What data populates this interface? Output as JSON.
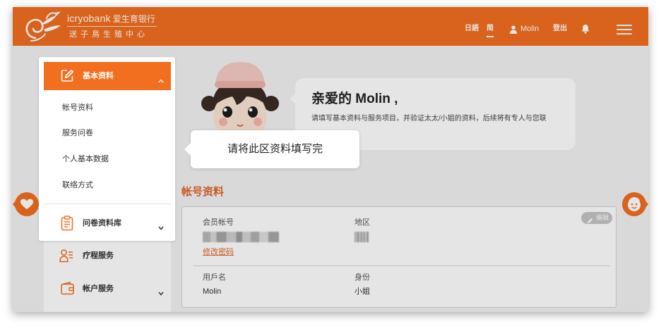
{
  "header": {
    "logo_icon": "stork-bird-logo",
    "brand_name": "icryobank",
    "brand_cn": "爱生育银行",
    "brand_sub": "送子鳥生殖中心",
    "lang_ja": "日語",
    "lang_zh": "简",
    "lang_zh_active": true,
    "user_icon": "user-icon",
    "user_name": "Molin",
    "logout": "登出",
    "notification_icon": "bell-icon",
    "menu_icon": "hamburger-menu-icon"
  },
  "sidebar": {
    "basic_info": {
      "label": "基本资料",
      "icon": "edit-square-icon",
      "expanded": true,
      "items": [
        "帐号资料",
        "服务问卷",
        "个人基本数据",
        "联络方式"
      ]
    },
    "questionnaire_library": {
      "label": "问卷资料库",
      "icon": "clipboard-icon",
      "expanded": false
    },
    "treatment_service": {
      "label": "疗程服务",
      "icon": "patient-list-icon"
    },
    "account_service": {
      "label": "帐户服务",
      "icon": "wallet-icon",
      "expanded": false
    }
  },
  "tooltip": {
    "text": "请将此区资料填写完"
  },
  "welcome": {
    "mascot": "nurse-mascot",
    "title": "亲爱的 Molin ,",
    "message": "请填写基本资料与服务项目，并验证太太/小姐的资料，后续将有专人与您联"
  },
  "account": {
    "section_title": "帐号资料",
    "edit_label": "编辑",
    "member_account_label": "会员帐号",
    "change_password_link": "修改密码",
    "region_label": "地区",
    "username_label": "用戶名",
    "username_value": "Molin",
    "identity_label": "身份",
    "identity_value": "小姐"
  },
  "side_tabs": {
    "left_icon": "heart-icon",
    "right_icon": "smiley-face-icon"
  },
  "colors": {
    "brand_orange": "#F26F20",
    "section_title": "#E0652A",
    "page_background": "#F2F2F2",
    "card_background": "#FFFFFF",
    "overlay": "#000000"
  }
}
